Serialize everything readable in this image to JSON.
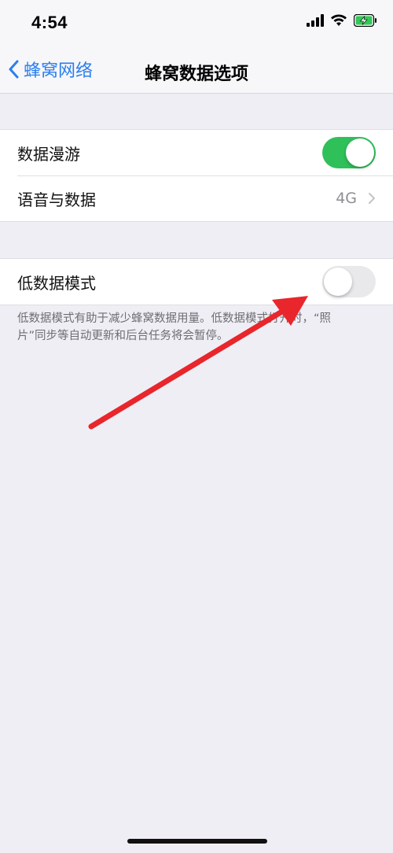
{
  "status_bar": {
    "time": "4:54"
  },
  "nav": {
    "back_label": "蜂窝网络",
    "title": "蜂窝数据选项"
  },
  "group1": {
    "roaming_label": "数据漫游",
    "roaming_enabled": true,
    "voice_data_label": "语音与数据",
    "voice_data_value": "4G"
  },
  "group2": {
    "low_data_label": "低数据模式",
    "low_data_enabled": false
  },
  "footnote": {
    "line1": "低数据模式有助于减少蜂窝数据用量。低数据模式打开时，“照",
    "line2": "片”同步等自动更新和后台任务将会暂停。"
  },
  "colors": {
    "accent": "#2a7ef0",
    "toggle_on": "#2fc05a",
    "annotation_arrow": "#e8262b"
  }
}
